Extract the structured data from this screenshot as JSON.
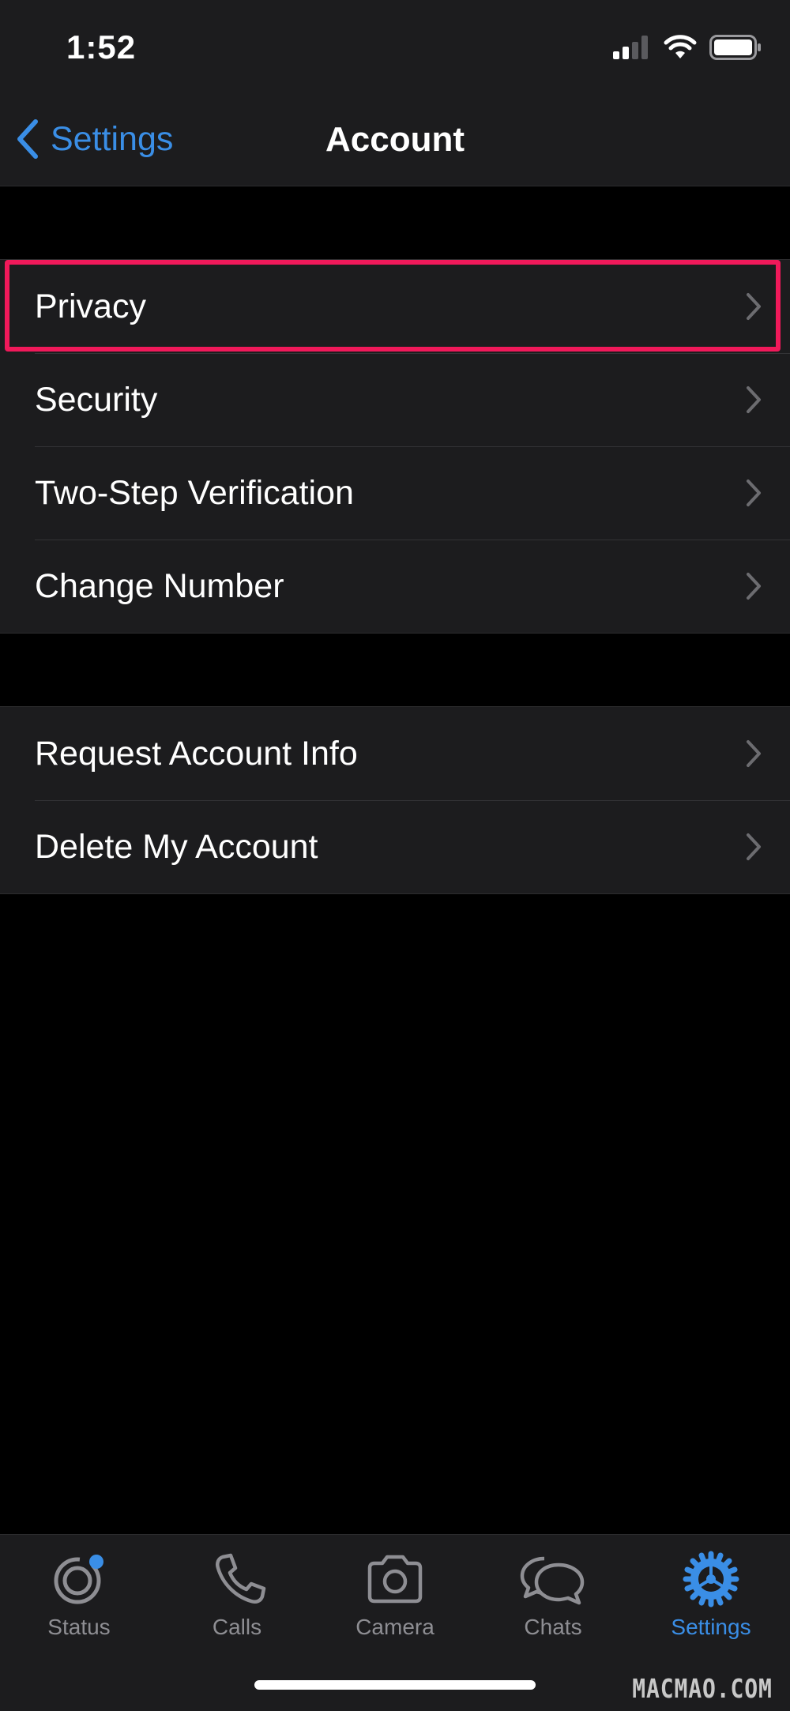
{
  "status_bar": {
    "time": "1:52",
    "icons": [
      "signal-icon",
      "wifi-icon",
      "battery-icon"
    ]
  },
  "nav": {
    "back_label": "Settings",
    "title": "Account"
  },
  "groups": [
    {
      "items": [
        "Privacy",
        "Security",
        "Two-Step Verification",
        "Change Number"
      ]
    },
    {
      "items": [
        "Request Account Info",
        "Delete My Account"
      ]
    }
  ],
  "highlighted_item": "Privacy",
  "tabs": [
    {
      "label": "Status",
      "icon": "status-icon",
      "badge": true
    },
    {
      "label": "Calls",
      "icon": "phone-icon"
    },
    {
      "label": "Camera",
      "icon": "camera-icon"
    },
    {
      "label": "Chats",
      "icon": "chat-bubbles-icon"
    },
    {
      "label": "Settings",
      "icon": "gear-icon",
      "active": true
    }
  ],
  "watermark": "MACMAO.COM",
  "colors": {
    "accent": "#3a8ee6",
    "highlight": "#f0195a",
    "background": "#000000",
    "cell": "#1c1c1e"
  }
}
